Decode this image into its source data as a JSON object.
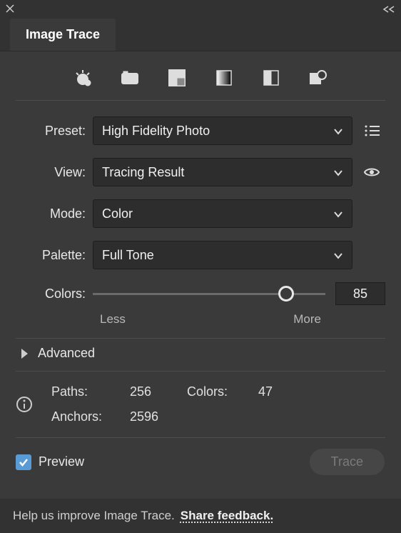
{
  "panel": {
    "title": "Image Trace"
  },
  "fields": {
    "preset": {
      "label": "Preset:",
      "value": "High Fidelity Photo"
    },
    "view": {
      "label": "View:",
      "value": "Tracing Result"
    },
    "mode": {
      "label": "Mode:",
      "value": "Color"
    },
    "palette": {
      "label": "Palette:",
      "value": "Full Tone"
    },
    "colors": {
      "label": "Colors:",
      "value": "85",
      "min_label": "Less",
      "max_label": "More"
    }
  },
  "advanced": {
    "label": "Advanced"
  },
  "info": {
    "paths_label": "Paths:",
    "paths_value": "256",
    "anchors_label": "Anchors:",
    "anchors_value": "2596",
    "colors_label": "Colors:",
    "colors_value": "47"
  },
  "actions": {
    "preview_label": "Preview",
    "preview_checked": true,
    "trace_label": "Trace"
  },
  "footer": {
    "text": "Help us improve Image Trace.",
    "link": "Share feedback."
  }
}
